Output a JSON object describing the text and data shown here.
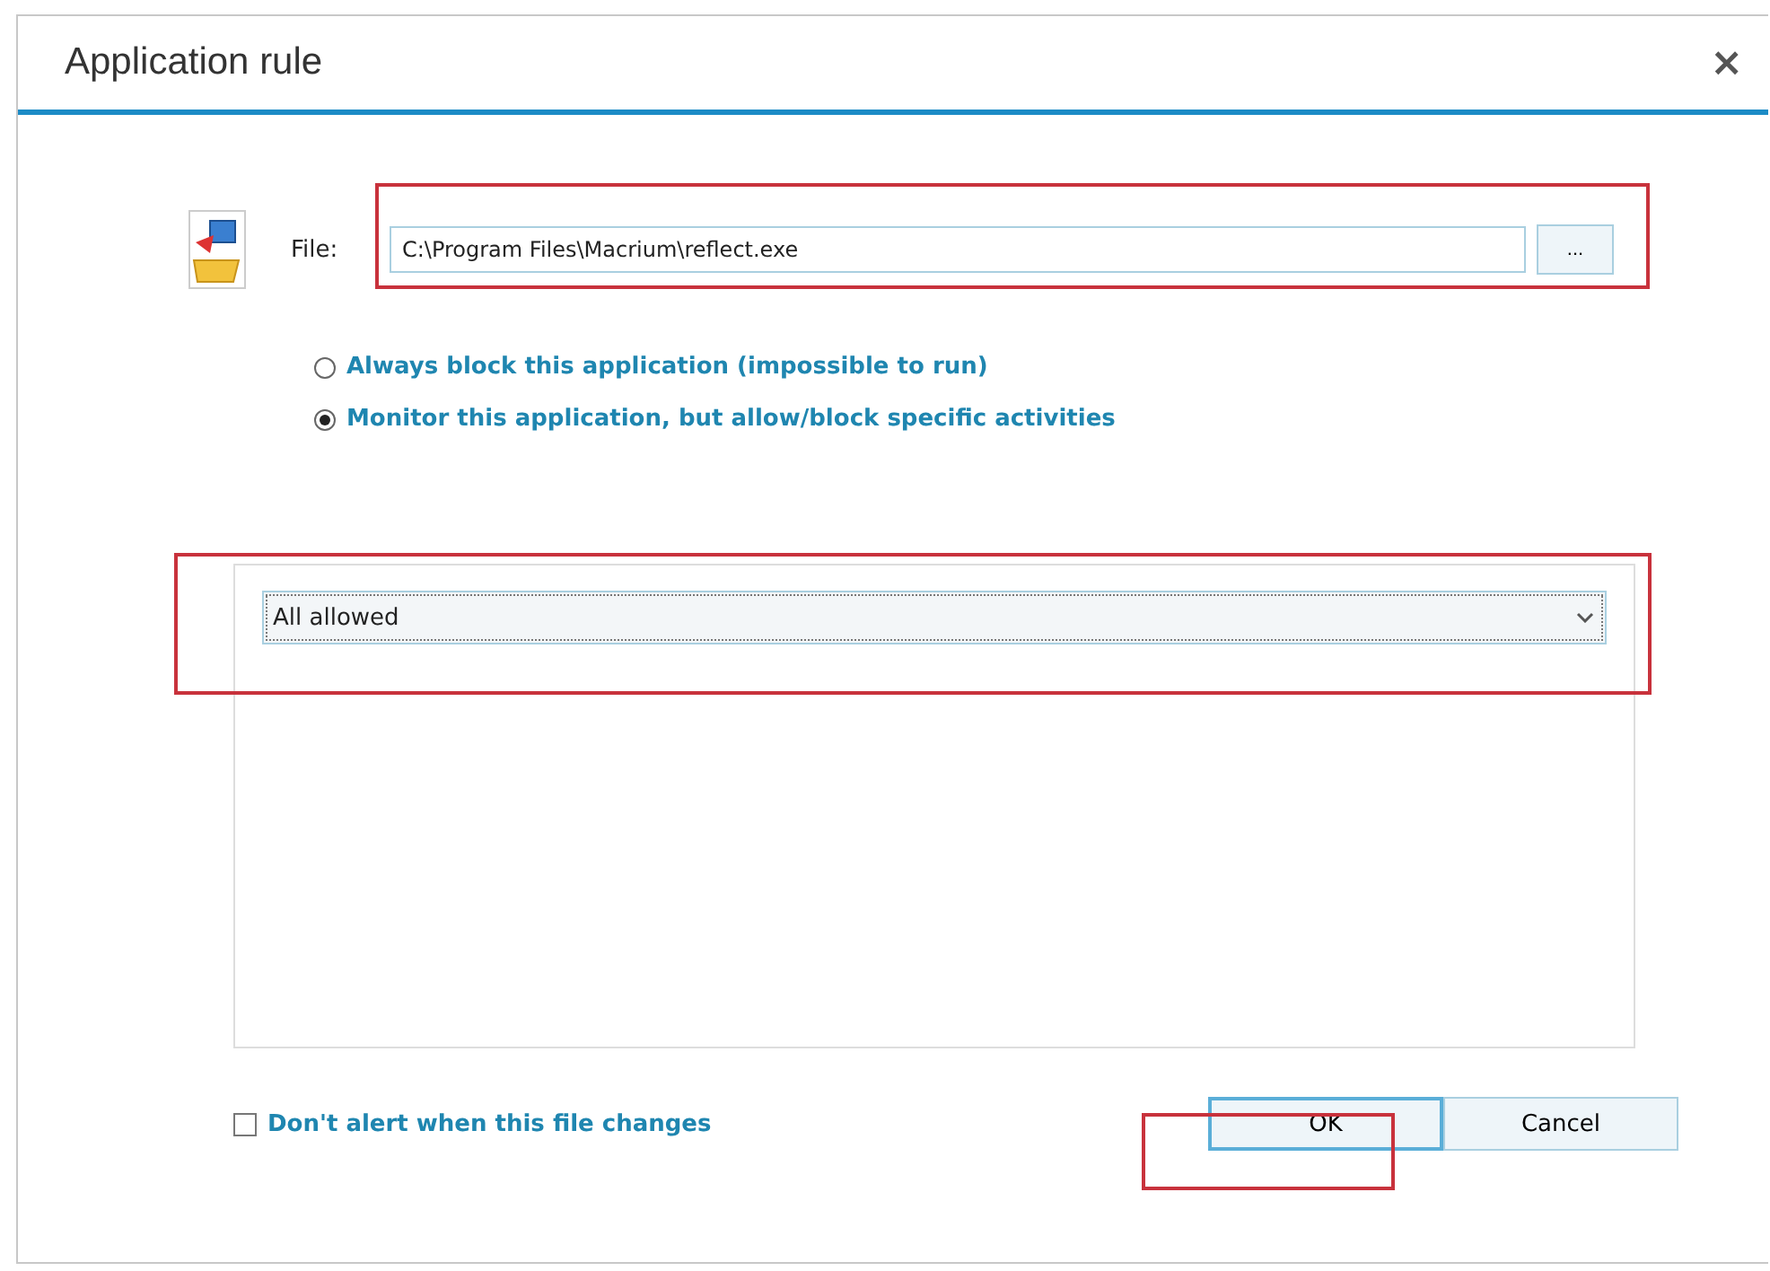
{
  "window": {
    "title": "Application rule",
    "close": "×"
  },
  "file": {
    "label": "File:",
    "value": "C:\\Program Files\\Macrium\\reflect.exe",
    "browse": "..."
  },
  "options": [
    {
      "label": "Always block this application (impossible to run)",
      "selected": false
    },
    {
      "label": "Monitor this application, but allow/block specific activities",
      "selected": true
    }
  ],
  "activity": {
    "value": "All allowed"
  },
  "alert": {
    "label": "Don't alert when this file changes",
    "checked": false
  },
  "buttons": [
    "OK",
    "Cancel"
  ]
}
